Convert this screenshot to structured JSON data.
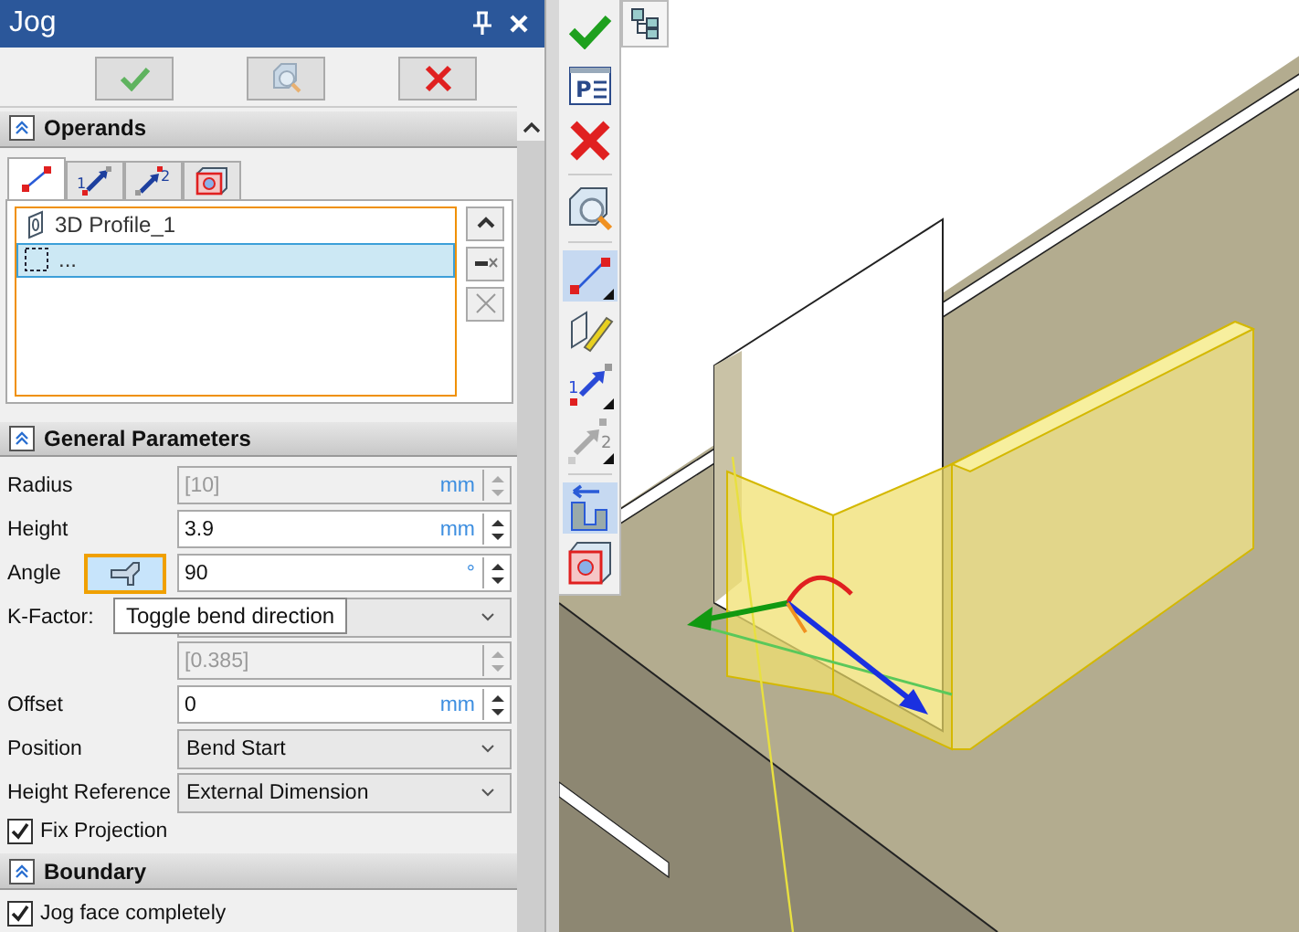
{
  "window": {
    "title": "Jog"
  },
  "actions": [
    {
      "kind": "ok"
    },
    {
      "kind": "preview"
    },
    {
      "kind": "cancel"
    }
  ],
  "sections": [
    {
      "title": "Operands",
      "expanded": true,
      "kind": "operands",
      "tabs": [
        {
          "kind": "edge",
          "selected": true
        },
        {
          "kind": "first",
          "digit": "1",
          "selected": false
        },
        {
          "kind": "second",
          "digit": "2",
          "selected": false
        },
        {
          "kind": "face",
          "selected": false
        }
      ],
      "items": [
        {
          "label": "3D Profile_1",
          "kind": "profile",
          "selected": false
        },
        {
          "label": "...",
          "kind": "empty",
          "selected": true
        }
      ]
    },
    {
      "title": "General Parameters",
      "expanded": true,
      "kind": "params",
      "rows": [
        {
          "kind": "spin",
          "label": "Radius",
          "value": "[10]",
          "unit": "mm",
          "disabled": true
        },
        {
          "kind": "spin",
          "label": "Height",
          "value": "3.9",
          "unit": "mm",
          "disabled": false
        },
        {
          "kind": "spin",
          "label": "Angle",
          "value": "90",
          "unit": "°",
          "disabled": false,
          "toggle": true,
          "tooltip": "Toggle bend direction"
        },
        {
          "kind": "dropdown",
          "label": "K-Factor:"
        },
        {
          "kind": "spin",
          "value": "[0.385]",
          "disabled": true
        },
        {
          "kind": "spin",
          "label": "Offset",
          "value": "0",
          "unit": "mm",
          "disabled": false
        },
        {
          "kind": "dropdown",
          "label": "Position",
          "value": "Bend Start"
        },
        {
          "kind": "dropdown",
          "label": "Height Reference",
          "value": "External Dimension"
        },
        {
          "kind": "checkbox",
          "label": "Fix Projection",
          "checked": true
        }
      ]
    },
    {
      "title": "Boundary",
      "expanded": true,
      "kind": "params",
      "rows": [
        {
          "kind": "checkbox",
          "label": "Jog face completely",
          "checked": true
        }
      ]
    }
  ],
  "toolbar": [
    {
      "kind": "ok",
      "selected": false
    },
    {
      "kind": "params",
      "digit": "P",
      "selected": false
    },
    {
      "kind": "cancel",
      "selected": false
    },
    {
      "kind": "sep"
    },
    {
      "kind": "preview",
      "selected": false
    },
    {
      "kind": "sep"
    },
    {
      "kind": "edge",
      "selected": true
    },
    {
      "kind": "sketch",
      "selected": false
    },
    {
      "kind": "first",
      "digit": "1",
      "selected": false
    },
    {
      "kind": "second",
      "digit": "2",
      "selected": false
    },
    {
      "kind": "sep"
    },
    {
      "kind": "jog",
      "selected": true
    },
    {
      "kind": "face",
      "selected": false
    }
  ]
}
